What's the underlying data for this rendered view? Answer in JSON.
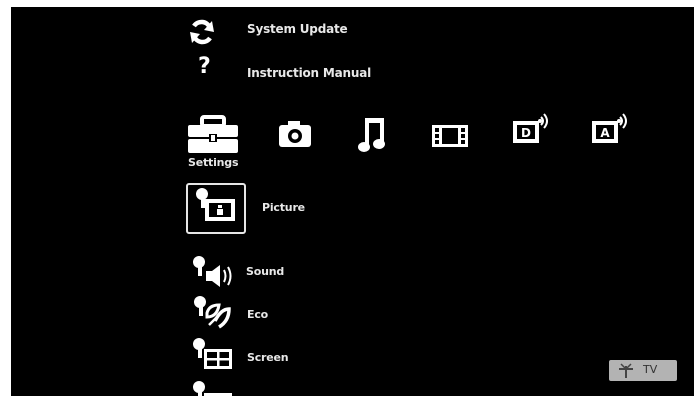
{
  "top_menu": {
    "system_update": {
      "label": "System Update",
      "icon": "refresh-icon"
    },
    "instruction_manual": {
      "label": "Instruction Manual",
      "icon": "question-icon",
      "glyph": "?"
    }
  },
  "categories": {
    "settings": {
      "label": "Settings",
      "icon": "toolbox-icon",
      "selected": true
    },
    "photo": {
      "icon": "camera-icon"
    },
    "music": {
      "icon": "music-note-icon"
    },
    "video": {
      "icon": "film-strip-icon"
    },
    "digital": {
      "icon": "digital-broadcast-icon",
      "letter": "D"
    },
    "analog": {
      "icon": "analog-broadcast-icon",
      "letter": "A"
    }
  },
  "settings_list": {
    "items": [
      {
        "label": "Picture",
        "icon": "picture-settings-icon",
        "selected": true
      },
      {
        "label": "Sound",
        "icon": "sound-settings-icon"
      },
      {
        "label": "Eco",
        "icon": "eco-settings-icon"
      },
      {
        "label": "Screen",
        "icon": "screen-settings-icon"
      }
    ]
  },
  "input_badge": {
    "label": "TV",
    "icon": "antenna-icon"
  },
  "colors": {
    "background": "#000000",
    "text": "#e8e8e8",
    "badge": "#b3b3b3"
  }
}
